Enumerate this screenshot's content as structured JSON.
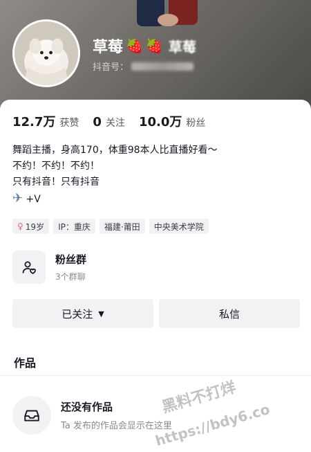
{
  "profile": {
    "nickname": "草莓",
    "nickname_tail": "草莓",
    "strawberry_icon": "🍓",
    "douyin_id_label": "抖音号：",
    "avatar": "white-puppy-avatar"
  },
  "stats": [
    {
      "value": "12.7万",
      "label": "获赞"
    },
    {
      "value": "0",
      "label": "关注"
    },
    {
      "value": "10.0万",
      "label": "粉丝"
    }
  ],
  "bio": {
    "lines": [
      "舞蹈主播，身高170，体重98本人比直播好看～",
      "不约！不约！不约！",
      "只有抖音！只有抖音"
    ],
    "plane_icon": "✈",
    "plane_suffix": "+V"
  },
  "tags": [
    {
      "icon": "♀",
      "text": "19岁"
    },
    {
      "text": "IP：重庆"
    },
    {
      "text": "福建·莆田"
    },
    {
      "text": "中央美术学院"
    }
  ],
  "fan_group": {
    "title": "粉丝群",
    "subtitle": "3个群聊",
    "icon": "user-heart-icon"
  },
  "actions": {
    "following_label": "已关注",
    "caret": "▼",
    "message_label": "私信"
  },
  "works": {
    "title": "作品",
    "empty_title": "还没有作品",
    "empty_subtitle": "Ta 发布的作品会显示在这里",
    "empty_icon": "inbox-tray-icon"
  },
  "watermark": {
    "line1": "黑料不打烊",
    "line2": "https://bdy6.co"
  },
  "colors": {
    "accent_pink": "#f05a8e",
    "text_primary": "#161823",
    "text_secondary": "#8a8a90",
    "chip_bg": "#f2f2f4"
  }
}
